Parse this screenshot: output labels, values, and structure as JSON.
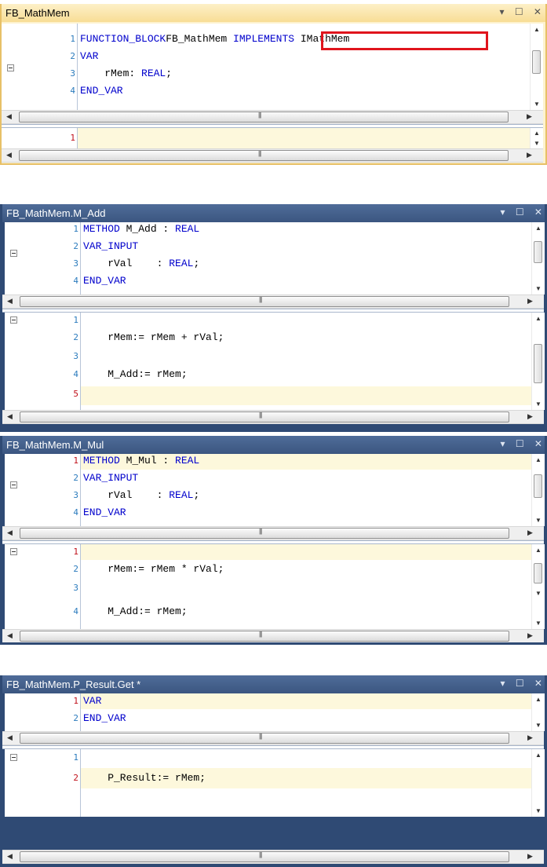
{
  "windows": [
    {
      "title": "FB_MathMem",
      "decl": [
        {
          "n": "1",
          "code": [
            [
              "kw",
              "FUNCTION_BLOCK"
            ],
            [
              "",
              "FB_MathMem "
            ],
            [
              "kw",
              "IMPLEMENTS"
            ],
            [
              "",
              " IMathMem"
            ]
          ]
        },
        {
          "n": "2",
          "code": [
            [
              "kw",
              "VAR"
            ]
          ]
        },
        {
          "n": "3",
          "code": [
            [
              "",
              "    rMem: "
            ],
            [
              "kw",
              "REAL"
            ],
            [
              "",
              ";"
            ]
          ]
        },
        {
          "n": "4",
          "code": [
            [
              "kw",
              "END_VAR"
            ]
          ]
        }
      ],
      "impl": [
        {
          "n": "1",
          "code": []
        }
      ]
    },
    {
      "title": "FB_MathMem.M_Add",
      "decl": [
        {
          "n": "1",
          "code": [
            [
              "kw",
              "METHOD"
            ],
            [
              "",
              " M_Add : "
            ],
            [
              "kw",
              "REAL"
            ]
          ]
        },
        {
          "n": "2",
          "code": [
            [
              "kw",
              "VAR_INPUT"
            ]
          ]
        },
        {
          "n": "3",
          "code": [
            [
              "",
              "    rVal    : "
            ],
            [
              "kw",
              "REAL"
            ],
            [
              "",
              ";"
            ]
          ]
        },
        {
          "n": "4",
          "code": [
            [
              "kw",
              "END_VAR"
            ]
          ]
        }
      ],
      "impl": [
        {
          "n": "1",
          "code": []
        },
        {
          "n": "2",
          "code": [
            [
              "",
              "    rMem:= rMem + rVal;"
            ]
          ]
        },
        {
          "n": "3",
          "code": []
        },
        {
          "n": "4",
          "code": [
            [
              "",
              "    M_Add:= rMem;"
            ]
          ]
        },
        {
          "n": "5",
          "code": []
        }
      ]
    },
    {
      "title": "FB_MathMem.M_Mul",
      "decl": [
        {
          "n": "1",
          "code": [
            [
              "kw",
              "METHOD"
            ],
            [
              "",
              " M_Mul : "
            ],
            [
              "kw",
              "REAL"
            ]
          ]
        },
        {
          "n": "2",
          "code": [
            [
              "kw",
              "VAR_INPUT"
            ]
          ]
        },
        {
          "n": "3",
          "code": [
            [
              "",
              "    rVal    : "
            ],
            [
              "kw",
              "REAL"
            ],
            [
              "",
              ";"
            ]
          ]
        },
        {
          "n": "4",
          "code": [
            [
              "kw",
              "END_VAR"
            ]
          ]
        }
      ],
      "impl": [
        {
          "n": "1",
          "code": []
        },
        {
          "n": "2",
          "code": [
            [
              "",
              "    rMem:= rMem * rVal;"
            ]
          ]
        },
        {
          "n": "3",
          "code": []
        },
        {
          "n": "4",
          "code": [
            [
              "",
              "    M_Add:= rMem;"
            ]
          ]
        }
      ]
    },
    {
      "title": "FB_MathMem.P_Result.Get *",
      "decl": [
        {
          "n": "1",
          "code": [
            [
              "kw",
              "VAR"
            ]
          ]
        },
        {
          "n": "2",
          "code": [
            [
              "kw",
              "END_VAR"
            ]
          ]
        }
      ],
      "impl": [
        {
          "n": "1",
          "code": []
        },
        {
          "n": "2",
          "code": [
            [
              "",
              "    P_Result:= rMem;"
            ]
          ]
        }
      ]
    }
  ],
  "title_buttons": "▾ ☐ ✕",
  "scroll": {
    "up": "▲",
    "down": "▼",
    "left": "◀",
    "right": "▶",
    "grip": "|||",
    "vgrip": "≡"
  },
  "highlight_color": "#e0141c"
}
